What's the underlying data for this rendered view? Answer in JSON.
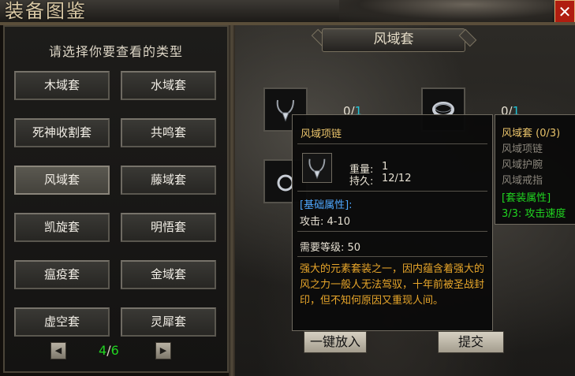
{
  "window": {
    "title": "装备图鉴",
    "close_symbol": "✕"
  },
  "left": {
    "heading": "请选择你要查看的类型",
    "sets": [
      "木域套",
      "水域套",
      "死神收割套",
      "共鸣套",
      "风域套",
      "藤域套",
      "凯旋套",
      "明悟套",
      "瘟疫套",
      "金域套",
      "虚空套",
      "灵犀套"
    ],
    "selected": "风域套",
    "pager": {
      "current": "4",
      "separator": "/",
      "total": "6",
      "prev_symbol": "◀",
      "next_symbol": "▶"
    }
  },
  "right": {
    "set_title": "风域套",
    "counts": [
      {
        "have": "0",
        "need": "1"
      },
      {
        "have": "0",
        "need": "1"
      }
    ],
    "actions": {
      "put_all": "一键放入",
      "submit": "提交"
    }
  },
  "tooltip": {
    "item_name": "风域项链",
    "weight_label": "重量:",
    "weight_value": "1",
    "durability_label": "持久:",
    "durability_value": "12/12",
    "base_title": "[基础属性]:",
    "attack": "攻击:  4-10",
    "level_req": "需要等级:  50",
    "description": "强大的元素套装之一，因内蕴含着强大的风之力一般人无法驾驭，十年前被圣战封印，但不知何原因又重现人间。"
  },
  "set_tooltip": {
    "title": "风域套 (0/3)",
    "pieces": [
      "风域项链",
      "风域护腕",
      "风域戒指"
    ],
    "attr_title": "[套装属性]",
    "bonus": "3/3:  攻击速度"
  },
  "colors": {
    "gold": "#e8c26a",
    "green": "#20d420",
    "cyan": "#20c4d8",
    "blue": "#4fa8ff",
    "orange": "#e8a62a"
  },
  "icons": [
    "necklace-icon",
    "bracelet-icon",
    "ring-icon",
    "dragon-ornament-icon"
  ]
}
